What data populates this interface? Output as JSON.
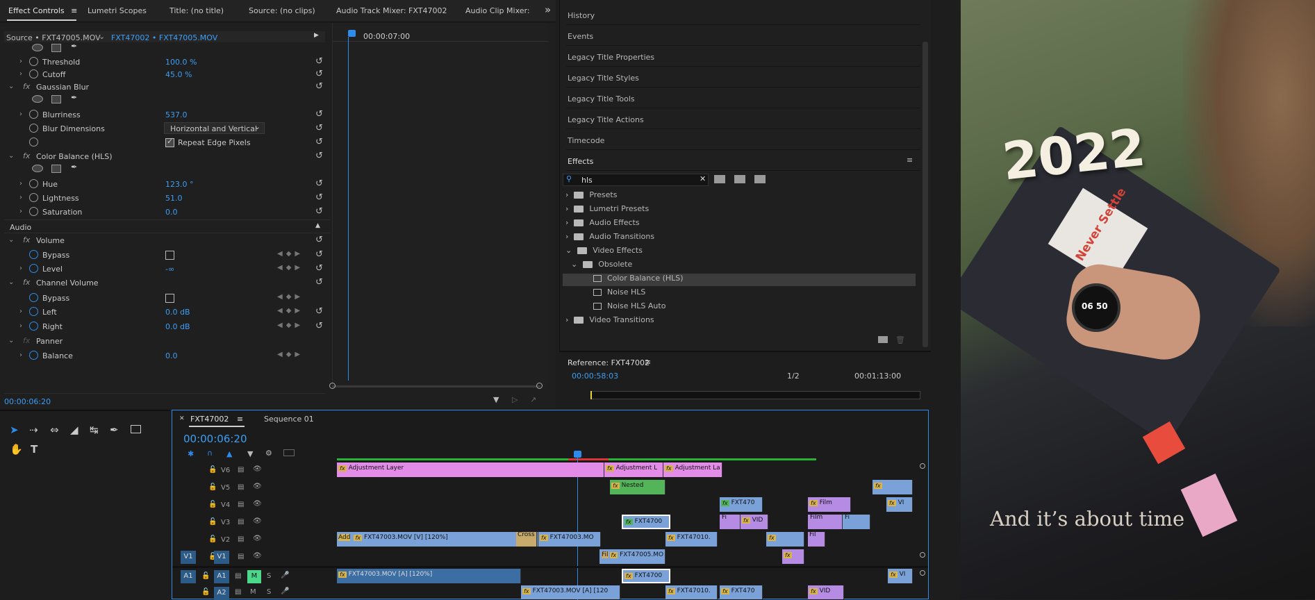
{
  "tabs": [
    {
      "label": "Effect Controls",
      "active": true
    },
    {
      "label": "Lumetri Scopes"
    },
    {
      "label": "Title: (no title)"
    },
    {
      "label": "Source: (no clips)"
    },
    {
      "label": "Audio Track Mixer: FXT47002"
    },
    {
      "label": "Audio Clip Mixer: F"
    }
  ],
  "ec": {
    "source": "Source • FXT47005.MOV",
    "sequence": "FXT47002 • FXT47005.MOV",
    "timecode_top": "00:00:07:00",
    "timecode_bottom": "00:00:06:20",
    "rows": {
      "threshold_label": "Threshold",
      "threshold_value": "100.0 %",
      "cutoff_label": "Cutoff",
      "cutoff_value": "45.0 %",
      "gaussian": "Gaussian Blur",
      "blurriness_label": "Blurriness",
      "blurriness_value": "537.0",
      "blurdim_label": "Blur Dimensions",
      "blurdim_value": "Horizontal and Vertical",
      "repeat_label": "Repeat Edge Pixels",
      "cbhls": "Color Balance (HLS)",
      "hue_label": "Hue",
      "hue_value": "123.0 °",
      "lightness_label": "Lightness",
      "lightness_value": "51.0",
      "saturation_label": "Saturation",
      "saturation_value": "0.0",
      "audio": "Audio",
      "volume": "Volume",
      "bypass_label": "Bypass",
      "level_label": "Level",
      "level_value": "-∞",
      "channel_volume": "Channel Volume",
      "bypass2_label": "Bypass",
      "left_label": "Left",
      "left_value": "0.0 dB",
      "right_label": "Right",
      "right_value": "0.0 dB",
      "panner": "Panner",
      "balance_label": "Balance",
      "balance_value": "0.0"
    }
  },
  "right_panels": [
    "History",
    "Events",
    "Legacy Title Properties",
    "Legacy Title Styles",
    "Legacy Title Tools",
    "Legacy Title Actions",
    "Timecode",
    "Effects"
  ],
  "effects": {
    "search_value": "hls",
    "tree": [
      {
        "label": "Presets",
        "level": 0
      },
      {
        "label": "Lumetri Presets",
        "level": 0
      },
      {
        "label": "Audio Effects",
        "level": 0
      },
      {
        "label": "Audio Transitions",
        "level": 0
      },
      {
        "label": "Video Effects",
        "level": 0
      },
      {
        "label": "Obsolete",
        "level": 1
      },
      {
        "label": "Color Balance (HLS)",
        "level": 2,
        "selected": true
      },
      {
        "label": "Noise HLS",
        "level": 2
      },
      {
        "label": "Noise HLS Auto",
        "level": 2
      },
      {
        "label": "Video Transitions",
        "level": 0
      }
    ]
  },
  "reference": {
    "title": "Reference: FXT47002",
    "timecode": "00:00:58:03",
    "page": "1/2",
    "duration": "00:01:13:00"
  },
  "timeline": {
    "tabs": [
      "FXT47002",
      "Sequence 01"
    ],
    "timecode": "00:00:06:20",
    "tracks": [
      "V6",
      "V5",
      "V4",
      "V3",
      "V2",
      "V1",
      "A1",
      "A2"
    ],
    "clips": {
      "adj1": "Adjustment Layer",
      "adj2": "Adjustment L",
      "adj3": "Adjustment La",
      "nested": "Nested",
      "film": "Film",
      "fxt470": "FXT470",
      "vid": "VID",
      "fxt4700": "FXT4700",
      "v2a": "FXT47003.MOV [V] [120%]",
      "cross": "Cross",
      "v2b": "FXT47003.MO",
      "v2c": "FXT47010.",
      "add": "Add",
      "v1a": "FXT47005.MO",
      "a1a": "FXT47003.MOV [A] [120%]",
      "a2a": "FXT47003.MOV [A] [120",
      "a2b": "FXT47010.",
      "vi": "VI",
      "fi": "Fi",
      "fil": "Fil"
    }
  },
  "preview": {
    "title": "2022",
    "caption": "And it’s about time",
    "sticker": "Never Settle",
    "watch": "06 50"
  }
}
